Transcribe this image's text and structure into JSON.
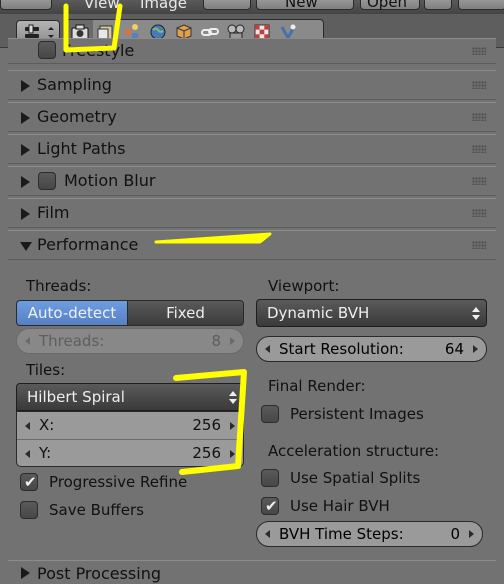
{
  "menubar": {
    "view_label": "View",
    "image_label": "Image",
    "new_label": "New",
    "open_label": "Open"
  },
  "toolbar": {
    "tabs": [
      {
        "icon": "camera-render-icon",
        "active": true
      },
      {
        "icon": "render-layers-icon",
        "active": false
      },
      {
        "icon": "scene-icon",
        "active": false
      },
      {
        "icon": "world-icon",
        "active": false
      },
      {
        "icon": "object-icon",
        "active": false
      },
      {
        "icon": "constraints-icon",
        "active": false
      },
      {
        "icon": "data-icon",
        "active": false
      },
      {
        "icon": "texture-checker-icon",
        "active": false
      },
      {
        "icon": "particles-icon",
        "active": false
      }
    ]
  },
  "panels": {
    "freestyle": "Freestyle",
    "sampling": "Sampling",
    "geometry": "Geometry",
    "light_paths": "Light Paths",
    "motion_blur": "Motion Blur",
    "film": "Film",
    "performance": "Performance",
    "post_processing": "Post Processing"
  },
  "performance": {
    "threads": {
      "label": "Threads:",
      "options": [
        "Auto-detect",
        "Fixed"
      ],
      "selected": "Auto-detect",
      "count_label": "Threads:",
      "count_value": "8"
    },
    "tiles": {
      "label": "Tiles:",
      "order": "Hilbert Spiral",
      "x_label": "X:",
      "x_value": "256",
      "y_label": "Y:",
      "y_value": "256"
    },
    "progressive_refine": {
      "label": "Progressive Refine",
      "checked": true
    },
    "save_buffers": {
      "label": "Save Buffers",
      "checked": false
    },
    "viewport": {
      "label": "Viewport:",
      "bvh": "Dynamic BVH",
      "start_resolution_label": "Start Resolution:",
      "start_resolution_value": "64"
    },
    "final_render": {
      "label": "Final Render:",
      "persistent_images": {
        "label": "Persistent Images",
        "checked": false
      }
    },
    "acceleration": {
      "label": "Acceleration structure:",
      "use_spatial_splits": {
        "label": "Use Spatial Splits",
        "checked": false
      },
      "use_hair_bvh": {
        "label": "Use Hair BVH",
        "checked": true
      },
      "bvh_time_steps_label": "BVH Time Steps:",
      "bvh_time_steps_value": "0"
    }
  },
  "colors": {
    "background": "#727272",
    "selected_button": "#5f8ad2",
    "annotation": "#ffff00"
  }
}
